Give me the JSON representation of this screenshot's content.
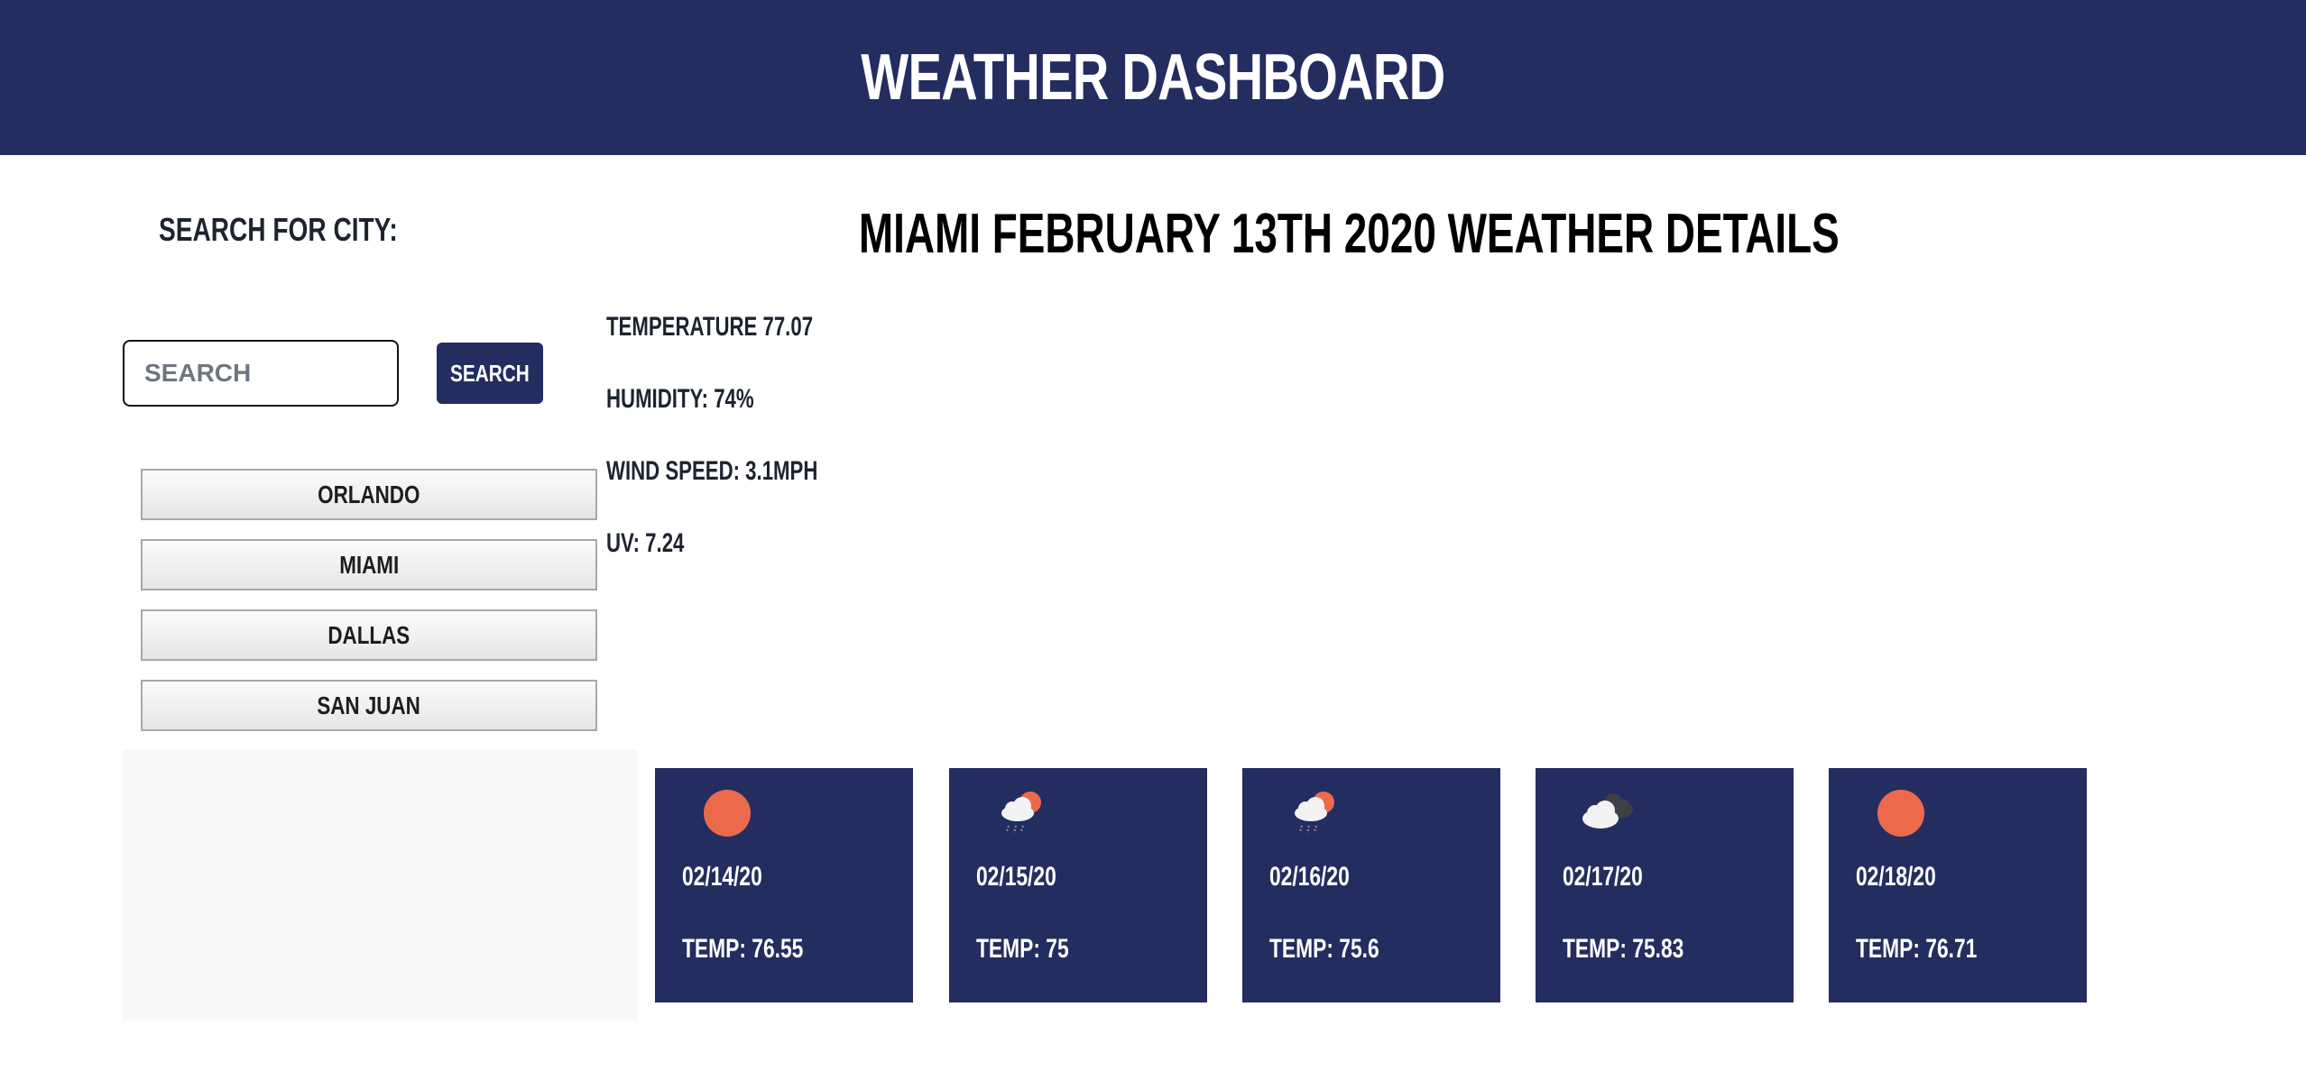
{
  "header": {
    "title": "WEATHER DASHBOARD"
  },
  "search": {
    "label": "SEARCH FOR CITY:",
    "placeholder": "SEARCH",
    "value": "",
    "button_label": "SEARCH"
  },
  "cities": [
    {
      "label": "ORLANDO"
    },
    {
      "label": "MIAMI"
    },
    {
      "label": "DALLAS"
    },
    {
      "label": "SAN JUAN"
    }
  ],
  "current": {
    "title": "MIAMI FEBRUARY 13TH 2020 WEATHER DETAILS",
    "temperature": "TEMPERATURE 77.07",
    "humidity": "HUMIDITY: 74%",
    "wind_speed": "WIND SPEED: 3.1MPH",
    "uv": "UV: 7.24"
  },
  "forecast": [
    {
      "icon": "sun-icon",
      "date": "02/14/20",
      "temp": "TEMP: 76.55"
    },
    {
      "icon": "sun-cloud-rain-icon",
      "date": "02/15/20",
      "temp": "TEMP: 75"
    },
    {
      "icon": "sun-cloud-rain-icon",
      "date": "02/16/20",
      "temp": "TEMP: 75.6"
    },
    {
      "icon": "clouds-icon",
      "date": "02/17/20",
      "temp": "TEMP: 75.83"
    },
    {
      "icon": "sun-icon",
      "date": "02/18/20",
      "temp": "TEMP: 76.71"
    }
  ],
  "colors": {
    "primary": "#232d5f",
    "sun": "#ec6a4c",
    "panel": "#f7f8f9"
  }
}
